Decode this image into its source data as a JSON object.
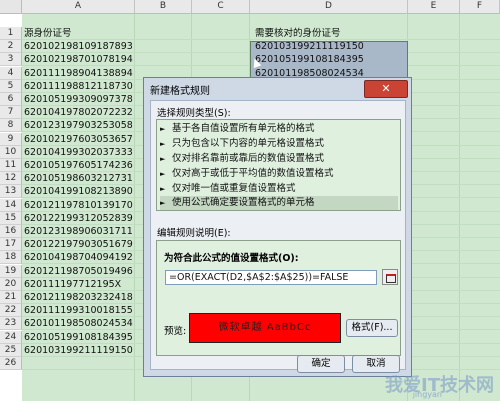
{
  "sheet": {
    "columns": [
      "A",
      "B",
      "C",
      "D",
      "E",
      "F"
    ],
    "header_A": "源身份证号",
    "header_D": "需要核对的身份证号",
    "col_a_values": [
      "620102198109187893",
      "620102198701078194",
      "620111198904138894",
      "620111198812118730",
      "620105199309097378",
      "620104197802072232",
      "620123197903253058",
      "620102197603053657",
      "620104199302037333",
      "620105197605174236",
      "620105198603212731",
      "620104199108213890",
      "620121197810139170",
      "620122199312052839",
      "620123198906031711",
      "620122197903051679",
      "620104198704094192",
      "620121198705019496",
      "620111197712195X",
      "620121198203232418",
      "620111199310018155",
      "620101198508024534",
      "620105199108184395",
      "620103199211119150"
    ],
    "col_d_values": [
      "620103199211119150",
      "620105199108184395",
      "620101198508024534"
    ]
  },
  "dialog": {
    "title": "新建格式规则",
    "close": "✕",
    "select_type_label": "选择规则类型(S):",
    "rule_types": [
      "基于各自值设置所有单元格的格式",
      "只为包含以下内容的单元格设置格式",
      "仅对排名靠前或靠后的数值设置格式",
      "仅对高于或低于平均值的数值设置格式",
      "仅对唯一值或重复值设置格式",
      "使用公式确定要设置格式的单元格"
    ],
    "edit_desc_label": "编辑规则说明(E):",
    "formula_label": "为符合此公式的值设置格式(O):",
    "formula_value": "=OR(EXACT(D2,$A$2:$A$25))=FALSE",
    "preview_label": "预览:",
    "preview_text": "微软卓越  AaBbCc",
    "format_button": "格式(F)...",
    "ok_button": "确定",
    "cancel_button": "取消"
  },
  "watermark": {
    "text": "我爱IT技术网",
    "sub": "jingyan"
  },
  "colors": {
    "sheet_bg": "#cfe8cf",
    "dialog_bg": "#cfd9e6",
    "close_red": "#c94434",
    "preview_red": "#ff0000"
  }
}
